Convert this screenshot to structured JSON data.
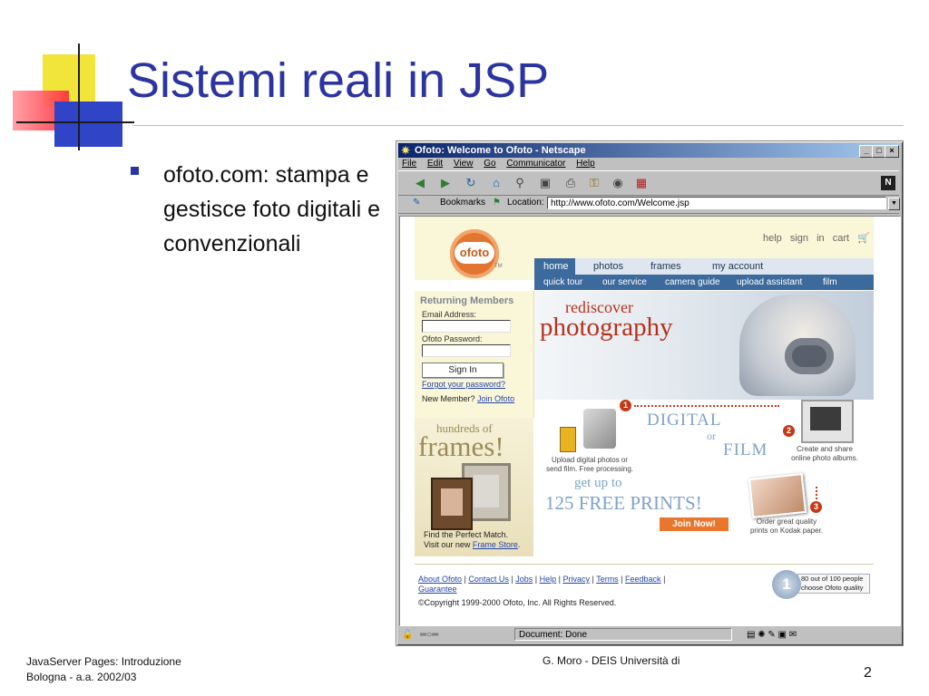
{
  "slide": {
    "title": "Sistemi reali in JSP",
    "bullet": "ofoto.com: stampa e gestisce foto digitali e convenzionali",
    "footer_left_line1": "JavaServer Pages: Introduzione",
    "footer_left_line2": "Bologna - a.a. 2002/03",
    "footer_right": "G. Moro - DEIS Università di",
    "page_number": "2",
    "colors": {
      "title": "#2c34a0",
      "bullet": "#2c34a0"
    }
  },
  "browser": {
    "title": "Ofoto: Welcome to Ofoto - Netscape",
    "menu": [
      "File",
      "Edit",
      "View",
      "Go",
      "Communicator",
      "Help"
    ],
    "bookmarks_label": "Bookmarks",
    "location_label": "Location:",
    "url": "http://www.ofoto.com/Welcome.jsp",
    "status": "Document: Done",
    "toolbar_icons": [
      "back-icon",
      "forward-icon",
      "reload-icon",
      "home-icon",
      "search-icon",
      "mynetscape-icon",
      "print-icon",
      "security-icon",
      "shop-icon",
      "stop-icon"
    ]
  },
  "ofoto": {
    "logo": "ofoto",
    "trademark": "TM",
    "top_links": [
      "help",
      "sign in",
      "cart"
    ],
    "nav_main": [
      "home",
      "photos",
      "frames",
      "my account"
    ],
    "nav_sub": [
      "quick tour",
      "our service",
      "camera guide",
      "upload assistant",
      "film"
    ],
    "login": {
      "title": "Returning Members",
      "email_label": "Email Address:",
      "password_label": "Ofoto Password:",
      "signin_button": "Sign In",
      "forgot": "Forgot your password?",
      "new_member": "New Member?",
      "join": "Join Ofoto"
    },
    "hero": {
      "line1": "rediscover",
      "line2": "photography"
    },
    "frames_promo": {
      "line1": "hundreds of",
      "line2": "frames!",
      "caption1": "Find the Perfect Match.",
      "caption2_prefix": "Visit our new",
      "caption2_link": "Frame Store"
    },
    "steps": {
      "digital": "DIGITAL",
      "or": "or",
      "film": "FILM",
      "upload_text_1": "Upload digital photos or",
      "upload_text_2": "send film. Free processing.",
      "share_text_1": "Create and share",
      "share_text_2": "online photo albums.",
      "order_text_1": "Order great quality",
      "order_text_2": "prints on Kodak paper.",
      "get_up_to": "get up to",
      "free_prints": "125 FREE PRINTS!",
      "join_now": "Join Now!",
      "numbers": [
        "1",
        "2",
        "3"
      ]
    },
    "footer": {
      "links": [
        "About Ofoto",
        "Contact Us",
        "Jobs",
        "Help",
        "Privacy",
        "Terms",
        "Feedback",
        "Guarantee"
      ],
      "copyright": "©Copyright 1999-2000 Ofoto, Inc. All Rights Reserved.",
      "badge_number": "1",
      "badge_line1": "80 out of 100 people",
      "badge_line2": "choose Ofoto quality"
    }
  }
}
